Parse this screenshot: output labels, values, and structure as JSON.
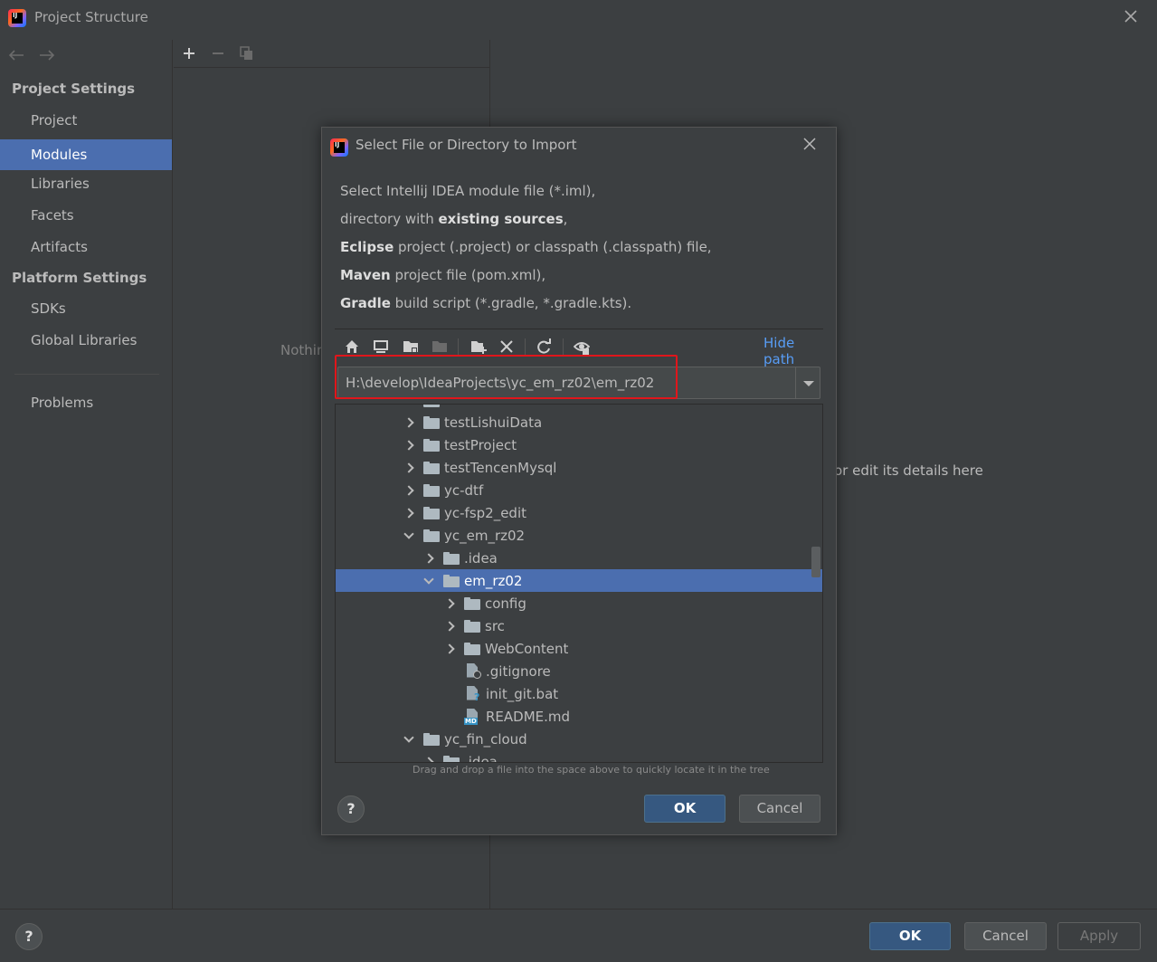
{
  "window": {
    "title": "Project Structure"
  },
  "sidebar": {
    "project_settings_heading": "Project Settings",
    "platform_settings_heading": "Platform Settings",
    "items": [
      {
        "label": "Project"
      },
      {
        "label": "Modules"
      },
      {
        "label": "Libraries"
      },
      {
        "label": "Facets"
      },
      {
        "label": "Artifacts"
      },
      {
        "label": "SDKs"
      },
      {
        "label": "Global Libraries"
      },
      {
        "label": "Problems"
      }
    ]
  },
  "middle": {
    "empty_text": "Nothin"
  },
  "right": {
    "hint_text": "or edit its details here"
  },
  "footer": {
    "ok_label": "OK",
    "cancel_label": "Cancel",
    "apply_label": "Apply",
    "help_label": "?"
  },
  "dialog": {
    "title": "Select File or Directory to Import",
    "desc": {
      "line1": "Select Intellij IDEA module file (*.iml),",
      "line2_pre": "directory with ",
      "line2_bold": "existing sources",
      "line2_post": ",",
      "line3_bold": "Eclipse",
      "line3_post": " project (.project) or classpath (.classpath) file,",
      "line4_bold": "Maven",
      "line4_post": " project file (pom.xml),",
      "line5_bold": "Gradle",
      "line5_post": " build script (*.gradle, *.gradle.kts)."
    },
    "hide_path_label": "Hide path",
    "path_value": "H:\\develop\\IdeaProjects\\yc_em_rz02\\em_rz02",
    "tree": [
      {
        "label": "testLishuiData",
        "kind": "folder"
      },
      {
        "label": "testProject",
        "kind": "folder"
      },
      {
        "label": "testTencenMysql",
        "kind": "folder"
      },
      {
        "label": "yc-dtf",
        "kind": "folder"
      },
      {
        "label": "yc-fsp2_edit",
        "kind": "folder"
      },
      {
        "label": "yc_em_rz02",
        "kind": "folder"
      },
      {
        "label": ".idea",
        "kind": "folder"
      },
      {
        "label": "em_rz02",
        "kind": "folder"
      },
      {
        "label": "config",
        "kind": "folder"
      },
      {
        "label": "src",
        "kind": "folder"
      },
      {
        "label": "WebContent",
        "kind": "folder"
      },
      {
        "label": ".gitignore",
        "kind": "file"
      },
      {
        "label": "init_git.bat",
        "kind": "file"
      },
      {
        "label": "README.md",
        "kind": "file"
      },
      {
        "label": "yc_fin_cloud",
        "kind": "folder"
      },
      {
        "label": ".idea",
        "kind": "folder"
      }
    ],
    "drag_hint": "Drag and drop a file into the space above to quickly locate it in the tree",
    "ok_label": "OK",
    "cancel_label": "Cancel",
    "help_label": "?"
  },
  "colors": {
    "background": "#3c3f41",
    "selection": "#4b6eaf",
    "primary_button": "#365880",
    "link": "#589df6",
    "highlight_box": "#e0161b"
  }
}
